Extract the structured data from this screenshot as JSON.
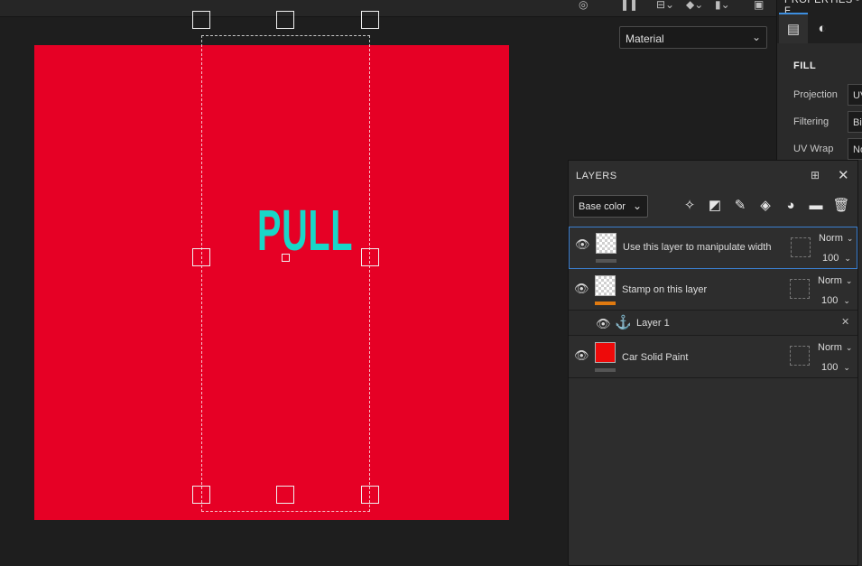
{
  "viewport": {
    "texture_color": "#e60025",
    "stamp_text": "PULL",
    "stamp_color": "#19d6c8",
    "material_dropdown": {
      "selected": "Material",
      "chevron_icon": "chevron-down-icon"
    }
  },
  "toolbar": {
    "icons": [
      "hidden-visibility-icon",
      "pause-icon",
      "split-view-icon",
      "cube-icon",
      "camera-icon",
      "screenshot-icon"
    ]
  },
  "properties": {
    "title": "PROPERTIES - F",
    "tabs": [
      {
        "icon": "fill-properties-icon",
        "active": true
      },
      {
        "icon": "material-sphere-icon",
        "active": false
      }
    ],
    "section": "FILL",
    "rows": [
      {
        "label": "Projection",
        "value": "UV"
      },
      {
        "label": "Filtering",
        "value": "Bil"
      },
      {
        "label": "UV Wrap",
        "value": "No"
      }
    ]
  },
  "layers": {
    "title": "LAYERS",
    "channel_select": "Base color",
    "tools": [
      "add-effect-icon",
      "add-mask-icon",
      "add-paint-layer-icon",
      "add-fill-layer-icon",
      "smart-material-icon",
      "add-folder-icon",
      "delete-icon"
    ],
    "items": [
      {
        "name": "Use this layer to manipulate width",
        "blend": "Norm",
        "opacity": "100",
        "thumb": "transparent",
        "selected": true
      },
      {
        "name": "Stamp on this layer",
        "blend": "Norm",
        "opacity": "100",
        "thumb": "transparent",
        "selected": false
      },
      {
        "name": "Car Solid Paint",
        "blend": "Norm",
        "opacity": "100",
        "thumb": "red",
        "selected": false
      }
    ],
    "sublayer": {
      "name": "Layer 1"
    }
  }
}
